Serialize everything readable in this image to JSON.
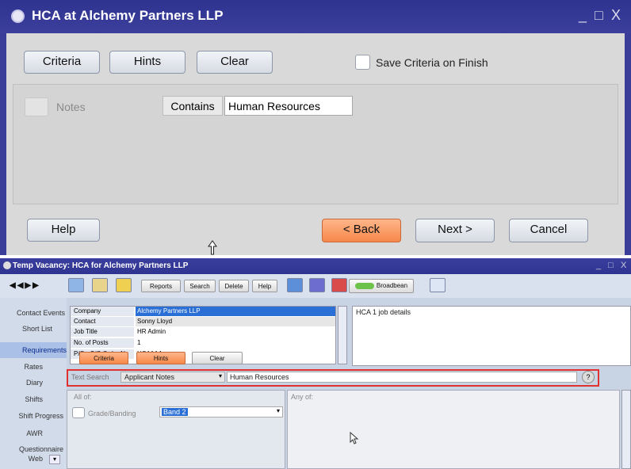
{
  "dialog": {
    "title": "HCA at Alchemy Partners LLP",
    "window_controls": [
      "_",
      "□",
      "X"
    ],
    "criteria_button": "Criteria",
    "hints_button": "Hints",
    "clear_button": "Clear",
    "save_criteria_label": "Save Criteria on Finish",
    "notes_label": "Notes",
    "contains_label": "Contains",
    "notes_value": "Human Resources",
    "help_button": "Help",
    "back_button": "< Back",
    "next_button": "Next >",
    "cancel_button": "Cancel"
  },
  "window": {
    "title": "Temp Vacancy: HCA for Alchemy Partners LLP",
    "window_controls": [
      "_",
      "□",
      "X"
    ],
    "toolbar": {
      "reports": "Reports",
      "search": "Search",
      "delete": "Delete",
      "help": "Help",
      "broadbean": "Broadbean"
    },
    "nav_items": [
      "Contact Events",
      "Short List",
      "Requirements",
      "Rates",
      "Diary",
      "Shifts",
      "Shift Progress",
      "AWR",
      "Questionnaire",
      "Web"
    ],
    "active_nav": "Requirements",
    "fields": [
      {
        "label": "Company",
        "value": "Alchemy Partners LLP"
      },
      {
        "label": "Contact",
        "value": "Sonny Lloyd"
      },
      {
        "label": "Job Title",
        "value": "HR Admin"
      },
      {
        "label": "No. of Posts",
        "value": "1"
      },
      {
        "label": "P/O - S/C Order N",
        "value": "HCA1AA"
      }
    ],
    "notes_text": "HCA 1 job details",
    "criteria_button": "Criteria",
    "hints_button": "Hints",
    "clear_button": "Clear",
    "text_search_label": "Text Search",
    "search_field": "Applicant Notes",
    "search_value": "Human Resources",
    "all_of_label": "All of:",
    "any_of_label": "Any of:",
    "grade_label": "Grade/Banding",
    "grade_value": "Band 2",
    "colors": {
      "highlight": "#e03030",
      "accent": "#f6884a",
      "title": "#2f3390"
    }
  }
}
